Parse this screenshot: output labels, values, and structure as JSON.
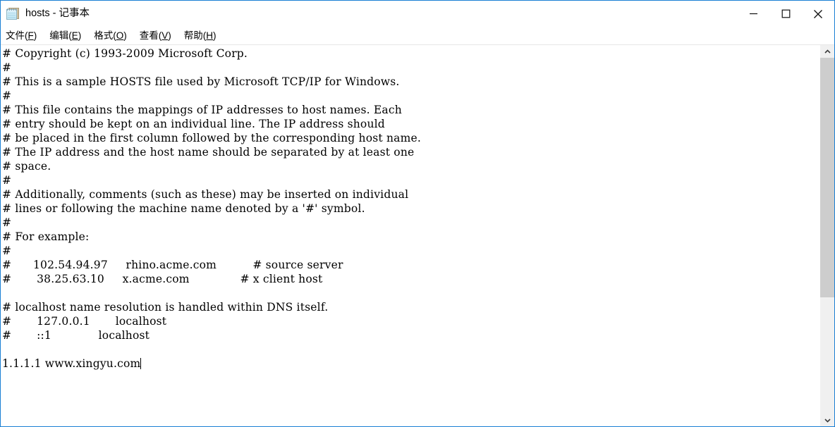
{
  "window": {
    "title": "hosts - 记事本",
    "icon": "notepad-icon",
    "border_color": "#1a7fd4",
    "controls": {
      "minimize_label": "最小化",
      "maximize_label": "最大化",
      "close_label": "关闭"
    }
  },
  "menubar": {
    "items": [
      {
        "label": "文件",
        "accelerator": "F"
      },
      {
        "label": "编辑",
        "accelerator": "E"
      },
      {
        "label": "格式",
        "accelerator": "O"
      },
      {
        "label": "查看",
        "accelerator": "V"
      },
      {
        "label": "帮助",
        "accelerator": "H"
      }
    ]
  },
  "editor": {
    "lines": [
      "# Copyright (c) 1993-2009 Microsoft Corp.",
      "#",
      "# This is a sample HOSTS file used by Microsoft TCP/IP for Windows.",
      "#",
      "# This file contains the mappings of IP addresses to host names. Each",
      "# entry should be kept on an individual line. The IP address should",
      "# be placed in the first column followed by the corresponding host name.",
      "# The IP address and the host name should be separated by at least one",
      "# space.",
      "#",
      "# Additionally, comments (such as these) may be inserted on individual",
      "# lines or following the machine name denoted by a '#' symbol.",
      "#",
      "# For example:",
      "#",
      "#      102.54.94.97     rhino.acme.com          # source server",
      "#       38.25.63.10     x.acme.com              # x client host",
      "",
      "# localhost name resolution is handled within DNS itself.",
      "#       127.0.0.1       localhost",
      "#       ::1             localhost",
      "",
      "1.1.1.1 www.xingyu.com"
    ],
    "caret_line_index": 22,
    "font_color": "#000000",
    "background": "#ffffff"
  },
  "scrollbar": {
    "up_arrow": "chevron-up-icon",
    "down_arrow": "chevron-down-icon",
    "thumb_color": "#cdcdcd",
    "track_color": "#f0f0f0"
  }
}
